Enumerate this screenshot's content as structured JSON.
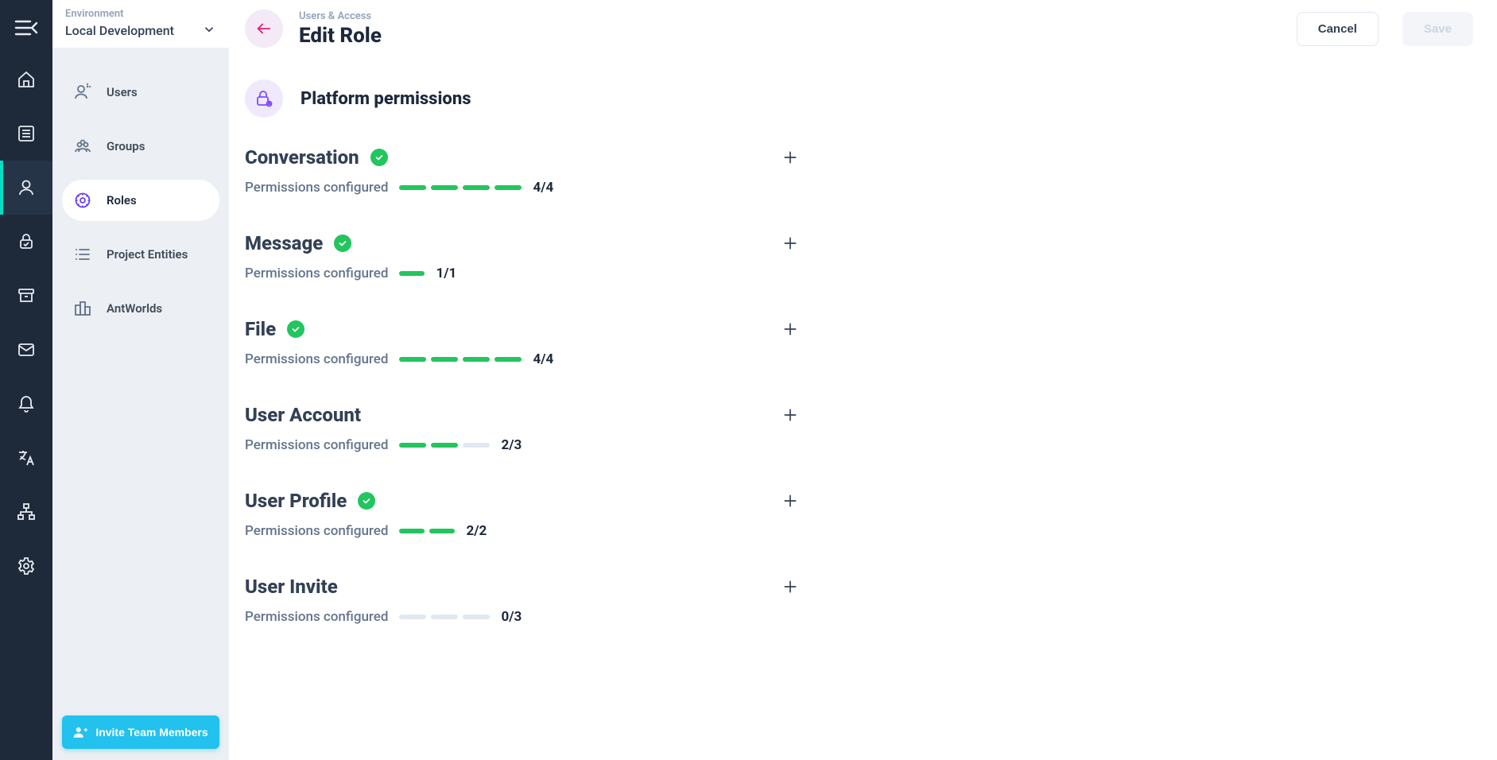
{
  "env": {
    "label": "Environment",
    "value": "Local Development"
  },
  "sidebar": {
    "items": [
      {
        "label": "Users"
      },
      {
        "label": "Groups"
      },
      {
        "label": "Roles"
      },
      {
        "label": "Project Entities"
      },
      {
        "label": "AntWorlds"
      }
    ],
    "active_index": 2,
    "invite_label": "Invite Team Members"
  },
  "header": {
    "breadcrumb": "Users & Access",
    "title": "Edit Role",
    "cancel_label": "Cancel",
    "save_label": "Save"
  },
  "section": {
    "title": "Platform permissions"
  },
  "config_label": "Permissions configured",
  "permissions": [
    {
      "name": "Conversation",
      "configured": 4,
      "total": 4,
      "all": true
    },
    {
      "name": "Message",
      "configured": 1,
      "total": 1,
      "all": true
    },
    {
      "name": "File",
      "configured": 4,
      "total": 4,
      "all": true
    },
    {
      "name": "User Account",
      "configured": 2,
      "total": 3,
      "all": false
    },
    {
      "name": "User Profile",
      "configured": 2,
      "total": 2,
      "all": true
    },
    {
      "name": "User Invite",
      "configured": 0,
      "total": 3,
      "all": false
    }
  ]
}
